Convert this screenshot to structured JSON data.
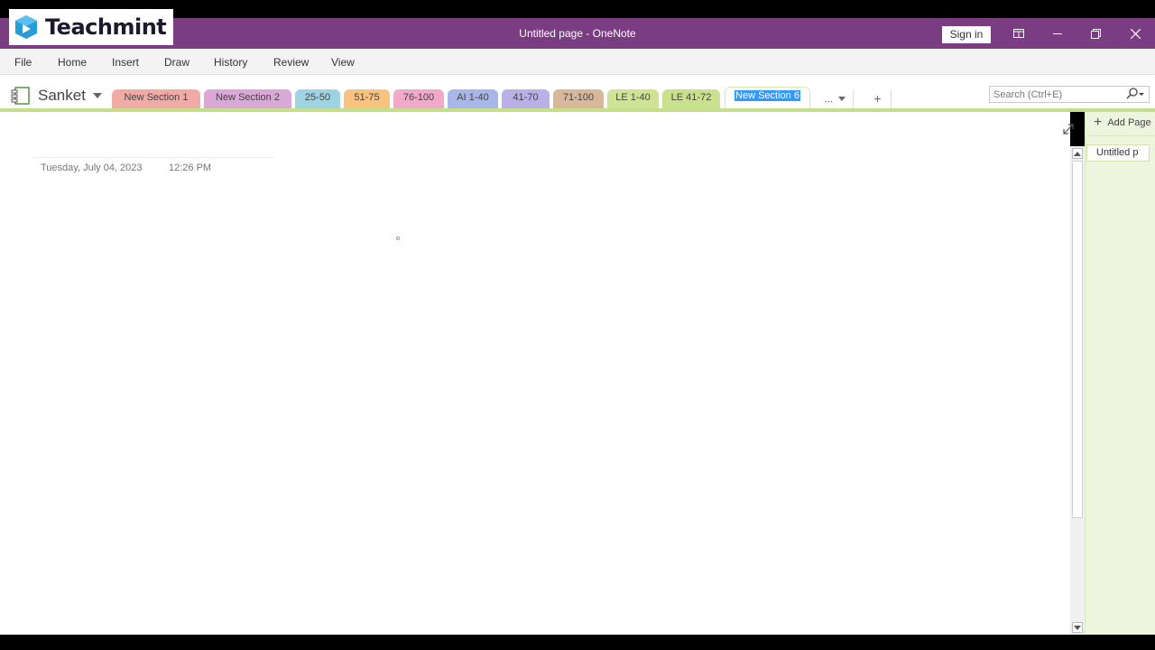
{
  "logo": {
    "text": "Teachmint"
  },
  "titlebar": {
    "title": "Untitled page  -  OneNote",
    "sign_in": "Sign in",
    "buttons": [
      "ribbon-display-icon",
      "minimize-icon",
      "restore-icon",
      "close-icon"
    ]
  },
  "menu": {
    "items": [
      "File",
      "Home",
      "Insert",
      "Draw",
      "History",
      "Review",
      "View"
    ]
  },
  "notebook": {
    "name": "Sanket",
    "sections": [
      {
        "label": "New Section 1",
        "color": "#f2aaa6"
      },
      {
        "label": "New Section 2",
        "color": "#d9a8d6"
      },
      {
        "label": "25-50",
        "color": "#9dd3e3"
      },
      {
        "label": "51-75",
        "color": "#f8c27f"
      },
      {
        "label": "76-100",
        "color": "#f2a8c8"
      },
      {
        "label": "AI 1-40",
        "color": "#a8b6e8"
      },
      {
        "label": "41-70",
        "color": "#b8b0e6"
      },
      {
        "label": "71-100",
        "color": "#d9b79a"
      },
      {
        "label": "LE 1-40",
        "color": "#cfe395"
      },
      {
        "label": "LE 41-72",
        "color": "#c9e08d"
      },
      {
        "label": "New Section 6",
        "color": "#c4de8a"
      }
    ],
    "more": "...",
    "add": "+"
  },
  "search": {
    "placeholder": "Search (Ctrl+E)"
  },
  "page": {
    "date": "Tuesday, July 04, 2023",
    "time": "12:26 PM"
  },
  "pages_pane": {
    "add_page": "Add Page",
    "pages": [
      "Untitled p"
    ]
  }
}
